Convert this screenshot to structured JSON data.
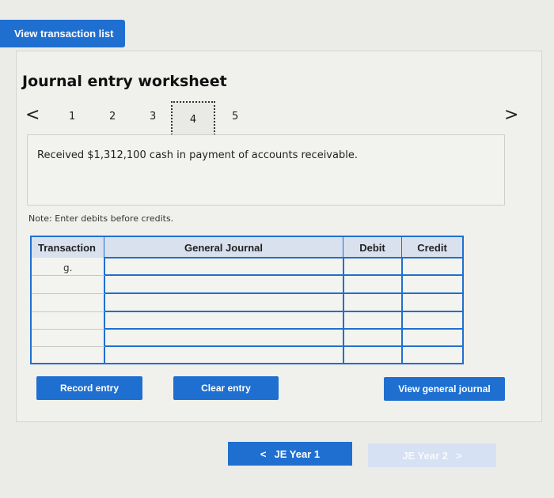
{
  "header": {
    "view_list_label": "View transaction list"
  },
  "worksheet": {
    "title": "Journal entry worksheet",
    "steps": [
      "1",
      "2",
      "3",
      "4",
      "5"
    ],
    "active_step": "4",
    "prev_arrow": "<",
    "next_arrow": ">",
    "description": "Received $1,312,100 cash in payment of accounts receivable.",
    "note": "Note: Enter debits before credits."
  },
  "table": {
    "headers": [
      "Transaction",
      "General Journal",
      "Debit",
      "Credit"
    ],
    "rows": [
      {
        "transaction": "g.",
        "general_journal": "",
        "debit": "",
        "credit": ""
      },
      {
        "transaction": "",
        "general_journal": "",
        "debit": "",
        "credit": ""
      },
      {
        "transaction": "",
        "general_journal": "",
        "debit": "",
        "credit": ""
      },
      {
        "transaction": "",
        "general_journal": "",
        "debit": "",
        "credit": ""
      },
      {
        "transaction": "",
        "general_journal": "",
        "debit": "",
        "credit": ""
      },
      {
        "transaction": "",
        "general_journal": "",
        "debit": "",
        "credit": ""
      }
    ]
  },
  "actions": {
    "record_entry": "Record entry",
    "clear_entry": "Clear entry",
    "view_general_journal": "View general journal"
  },
  "pagination": {
    "prev_label": "JE Year 1",
    "prev_icon": "<",
    "next_label": "JE Year 2",
    "next_icon": ">"
  },
  "colors": {
    "accent": "#1f6fd1",
    "disabled": "#d6e2f3"
  }
}
